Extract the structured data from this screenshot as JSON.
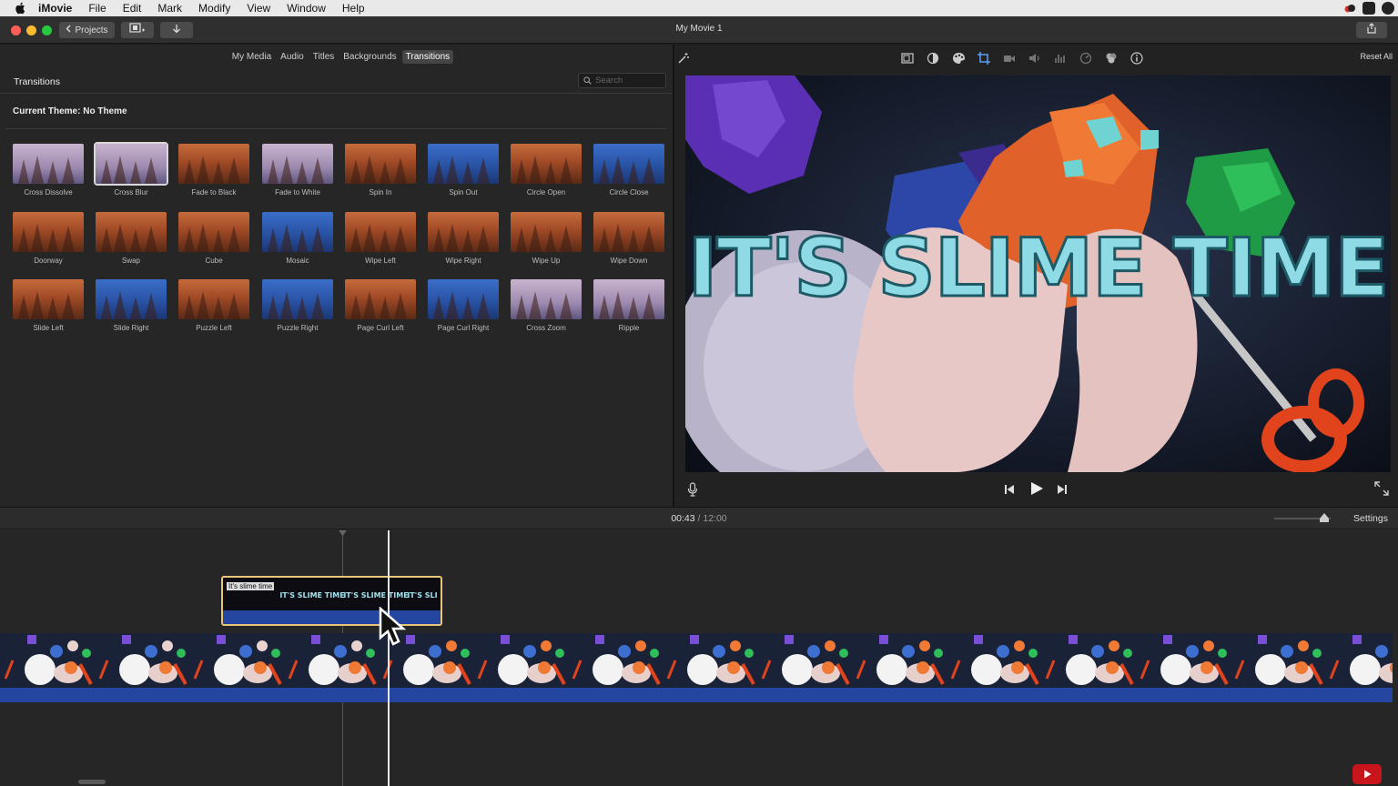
{
  "menubar": {
    "app": "iMovie",
    "items": [
      "File",
      "Edit",
      "Mark",
      "Modify",
      "View",
      "Window",
      "Help"
    ]
  },
  "toolbar": {
    "projects_label": "Projects",
    "window_title": "My Movie 1"
  },
  "browser": {
    "tabs": [
      "My Media",
      "Audio",
      "Titles",
      "Backgrounds",
      "Transitions"
    ],
    "active_tab": "Transitions",
    "library_title": "Transitions",
    "search_placeholder": "Search",
    "theme_label": "Current Theme: No Theme",
    "transitions": [
      {
        "label": "Cross Dissolve",
        "style": "pale"
      },
      {
        "label": "Cross Blur",
        "style": "pale",
        "selected": true
      },
      {
        "label": "Fade to Black",
        "style": "forest"
      },
      {
        "label": "Fade to White",
        "style": "pale"
      },
      {
        "label": "Spin In",
        "style": "forest"
      },
      {
        "label": "Spin Out",
        "style": "blue"
      },
      {
        "label": "Circle Open",
        "style": "forest"
      },
      {
        "label": "Circle Close",
        "style": "blue"
      },
      {
        "label": "Doorway",
        "style": "forest"
      },
      {
        "label": "Swap",
        "style": "forest"
      },
      {
        "label": "Cube",
        "style": "forest"
      },
      {
        "label": "Mosaic",
        "style": "blue"
      },
      {
        "label": "Wipe Left",
        "style": "forest"
      },
      {
        "label": "Wipe Right",
        "style": "forest"
      },
      {
        "label": "Wipe Up",
        "style": "forest"
      },
      {
        "label": "Wipe Down",
        "style": "forest"
      },
      {
        "label": "Slide Left",
        "style": "forest"
      },
      {
        "label": "Slide Right",
        "style": "blue"
      },
      {
        "label": "Puzzle Left",
        "style": "forest"
      },
      {
        "label": "Puzzle Right",
        "style": "blue"
      },
      {
        "label": "Page Curl Left",
        "style": "forest"
      },
      {
        "label": "Page Curl Right",
        "style": "blue"
      },
      {
        "label": "Cross Zoom",
        "style": "pale"
      },
      {
        "label": "Ripple",
        "style": "pale"
      }
    ]
  },
  "viewer": {
    "tools": [
      "crop-to-fill-icon",
      "color-balance-icon",
      "color-correction-icon",
      "crop-icon",
      "stabilization-icon",
      "volume-icon",
      "noise-reduction-icon",
      "speed-icon",
      "clip-filter-icon",
      "info-icon"
    ],
    "reset_label": "Reset All",
    "overlay_title": "IT'S SLIME TIME"
  },
  "timeline": {
    "current_time": "00:43",
    "separator": "/",
    "total_time": "12:00",
    "settings_label": "Settings",
    "title_clip_name": "It's slime time",
    "title_clip_frames": [
      "IT'S SLIME TIME",
      "IT'S SLIME TIME",
      "IT'S SLI"
    ]
  },
  "colors": {
    "accent_blue": "#2446a0",
    "selection_gold": "#e9c57a",
    "title_cyan": "#8fdbe5"
  }
}
